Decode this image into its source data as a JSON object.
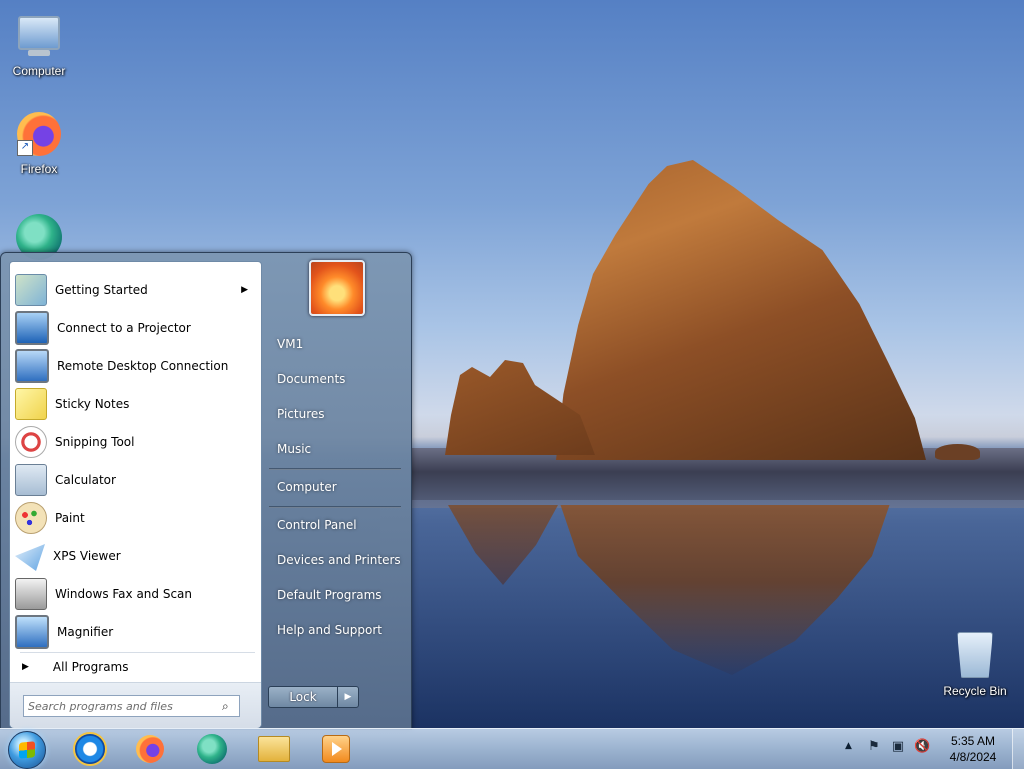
{
  "desktop": {
    "icons": [
      {
        "label": "Computer",
        "icon": "computer-icon"
      },
      {
        "label": "Firefox",
        "icon": "firefox-icon"
      },
      {
        "label": "",
        "icon": "edge-icon"
      },
      {
        "label": "Recycle Bin",
        "icon": "recycle-bin-icon"
      }
    ]
  },
  "start_menu": {
    "programs": [
      {
        "label": "Getting Started",
        "icon": "getting-started-icon",
        "has_submenu": true
      },
      {
        "label": "Connect to a Projector",
        "icon": "projector-icon"
      },
      {
        "label": "Remote Desktop Connection",
        "icon": "remote-desktop-icon"
      },
      {
        "label": "Sticky Notes",
        "icon": "sticky-notes-icon"
      },
      {
        "label": "Snipping Tool",
        "icon": "snipping-tool-icon"
      },
      {
        "label": "Calculator",
        "icon": "calculator-icon"
      },
      {
        "label": "Paint",
        "icon": "paint-icon"
      },
      {
        "label": "XPS Viewer",
        "icon": "xps-viewer-icon"
      },
      {
        "label": "Windows Fax and Scan",
        "icon": "fax-scan-icon"
      },
      {
        "label": "Magnifier",
        "icon": "magnifier-icon"
      }
    ],
    "all_programs": "All Programs",
    "search": {
      "placeholder": "Search programs and files"
    },
    "right_items": [
      "VM1",
      "Documents",
      "Pictures",
      "Music",
      "Computer",
      "Control Panel",
      "Devices and Printers",
      "Default Programs",
      "Help and Support"
    ],
    "shutdown_label": "Lock"
  },
  "taskbar": {
    "apps": [
      "internet-explorer-icon",
      "firefox-icon",
      "edge-icon",
      "file-explorer-icon",
      "media-player-icon"
    ],
    "clock": {
      "time": "5:35 AM",
      "date": "4/8/2024"
    }
  }
}
